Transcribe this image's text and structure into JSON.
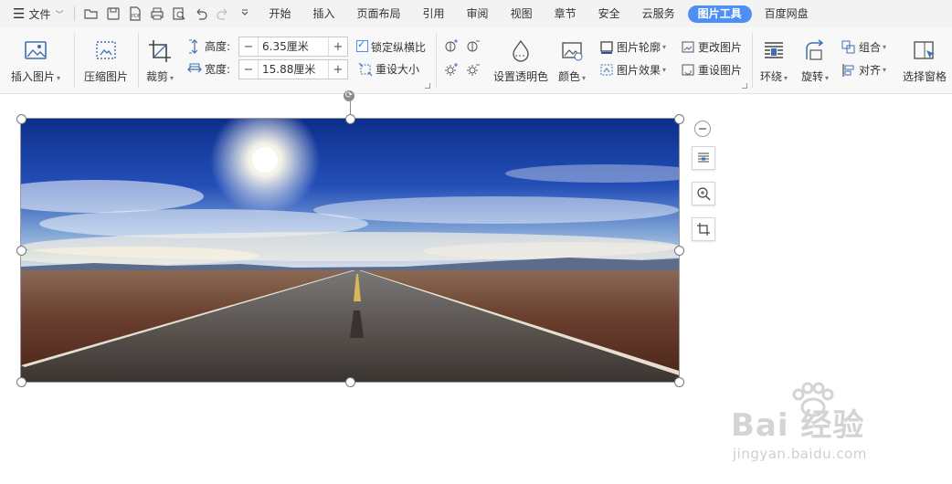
{
  "menubar": {
    "file_label": "文件",
    "tabs": [
      {
        "label": "开始",
        "active": false
      },
      {
        "label": "插入",
        "active": false
      },
      {
        "label": "页面布局",
        "active": false
      },
      {
        "label": "引用",
        "active": false
      },
      {
        "label": "审阅",
        "active": false
      },
      {
        "label": "视图",
        "active": false
      },
      {
        "label": "章节",
        "active": false
      },
      {
        "label": "安全",
        "active": false
      },
      {
        "label": "云服务",
        "active": false
      },
      {
        "label": "图片工具",
        "active": true
      },
      {
        "label": "百度网盘",
        "active": false
      }
    ],
    "accent_color": "#4d8ff4"
  },
  "ribbon": {
    "insert_picture": "插入图片",
    "compress_picture": "压缩图片",
    "crop": "裁剪",
    "height_label": "高度:",
    "height_value": "6.35厘米",
    "width_label": "宽度:",
    "width_value": "15.88厘米",
    "lock_ratio": "锁定纵横比",
    "lock_ratio_checked": true,
    "reset_size": "重设大小",
    "set_transparent": "设置透明色",
    "color": "颜色",
    "picture_outline": "图片轮廓",
    "picture_effect": "图片效果",
    "change_picture": "更改图片",
    "reset_picture": "重设图片",
    "wrap": "环绕",
    "rotate": "旋转",
    "group": "组合",
    "align": "对齐",
    "selection_pane": "选择窗格"
  },
  "watermark": {
    "main": "Bai 经验",
    "sub": "jingyan.baidu.com"
  }
}
